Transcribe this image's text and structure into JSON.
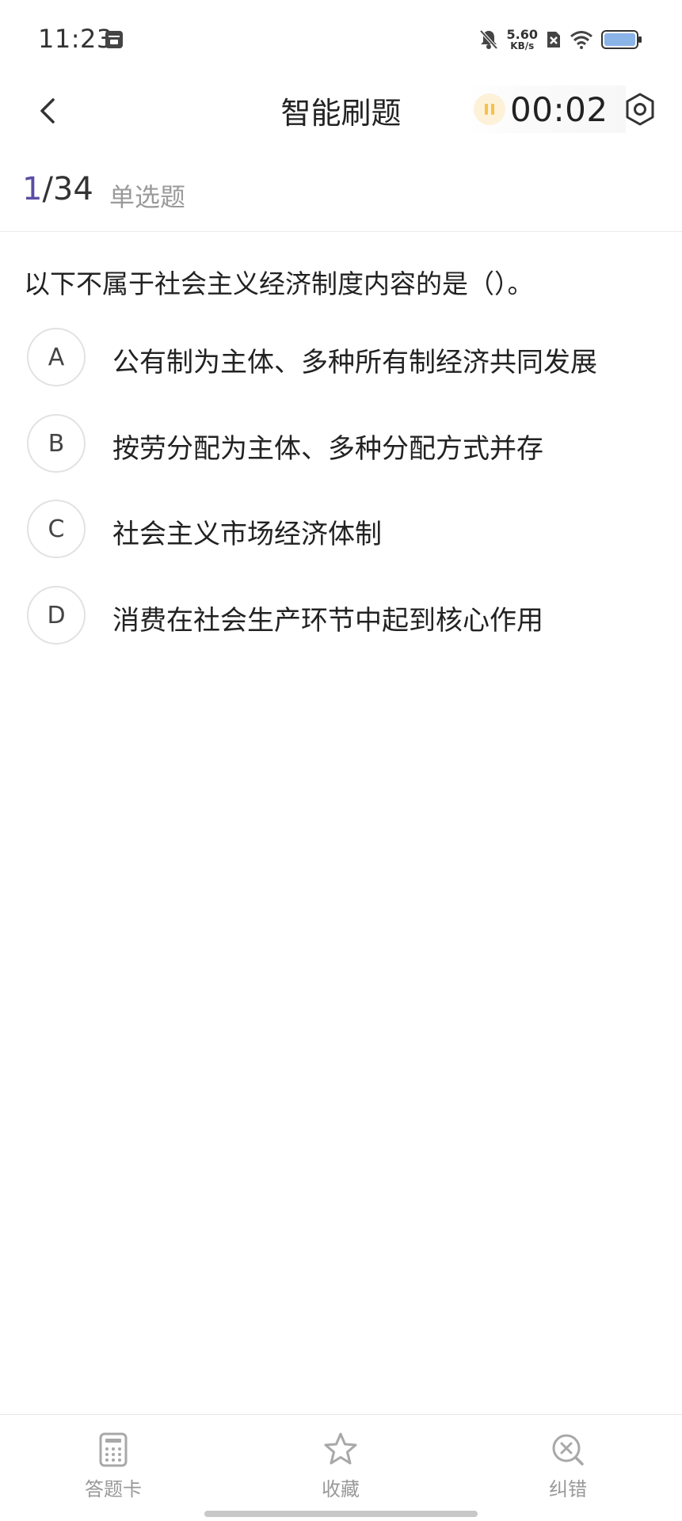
{
  "status_bar": {
    "time": "11:23",
    "net_speed_value": "5.60",
    "net_speed_unit": "KB/s",
    "icons": [
      "calendar-icon",
      "mute-bell-icon",
      "sim-blocked-icon",
      "wifi-icon",
      "battery-icon"
    ]
  },
  "header": {
    "title": "智能刷题",
    "timer": "00:02",
    "accent_color": "#f4c14a"
  },
  "progress": {
    "current": "1",
    "total": "/34",
    "question_type": "单选题",
    "current_color": "#5a4fa3"
  },
  "question": {
    "text": "以下不属于社会主义经济制度内容的是（）。",
    "options": [
      {
        "letter": "A",
        "text": "公有制为主体、多种所有制经济共同发展"
      },
      {
        "letter": "B",
        "text": "按劳分配为主体、多种分配方式并存"
      },
      {
        "letter": "C",
        "text": "社会主义市场经济体制"
      },
      {
        "letter": "D",
        "text": "消费在社会生产环节中起到核心作用"
      }
    ]
  },
  "bottom_bar": {
    "tabs": [
      {
        "label": "答题卡",
        "icon": "answer-card-icon"
      },
      {
        "label": "收藏",
        "icon": "star-icon"
      },
      {
        "label": "纠错",
        "icon": "correct-error-icon"
      }
    ]
  }
}
